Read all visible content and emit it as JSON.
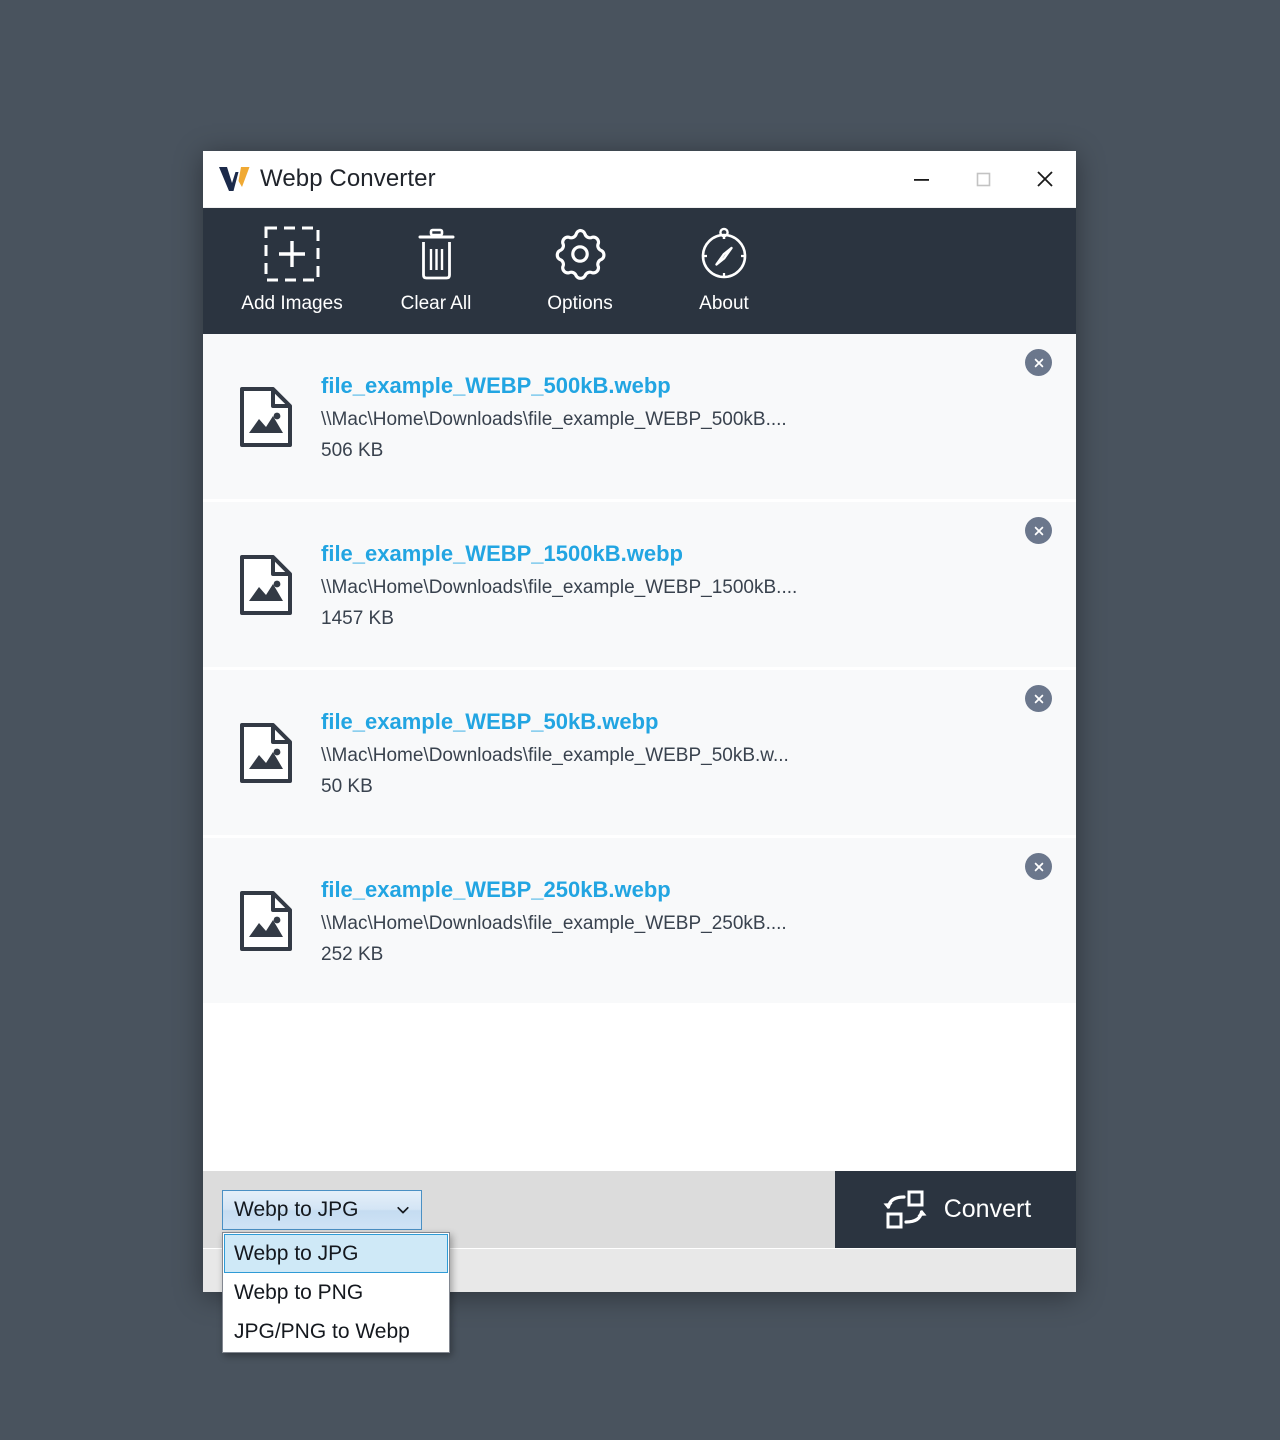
{
  "window": {
    "title": "Webp Converter",
    "logo_icon": "webp-converter-logo",
    "controls": [
      {
        "name": "minimize",
        "icon": "minimize-icon"
      },
      {
        "name": "maximize",
        "icon": "maximize-icon"
      },
      {
        "name": "close",
        "icon": "close-icon"
      }
    ]
  },
  "toolbar": {
    "items": [
      {
        "label": "Add Images",
        "icon": "add-images-icon"
      },
      {
        "label": "Clear All",
        "icon": "trash-icon"
      },
      {
        "label": "Options",
        "icon": "gear-icon"
      },
      {
        "label": "About",
        "icon": "compass-icon"
      }
    ]
  },
  "file_list": {
    "remove_icon": "close-circle-icon",
    "file_icon": "image-file-icon",
    "items": [
      {
        "name": "file_example_WEBP_500kB.webp",
        "path": "\\\\Mac\\Home\\Downloads\\file_example_WEBP_500kB....",
        "size": "506 KB"
      },
      {
        "name": "file_example_WEBP_1500kB.webp",
        "path": "\\\\Mac\\Home\\Downloads\\file_example_WEBP_1500kB....",
        "size": "1457 KB"
      },
      {
        "name": "file_example_WEBP_50kB.webp",
        "path": "\\\\Mac\\Home\\Downloads\\file_example_WEBP_50kB.w...",
        "size": "50 KB"
      },
      {
        "name": "file_example_WEBP_250kB.webp",
        "path": "\\\\Mac\\Home\\Downloads\\file_example_WEBP_250kB....",
        "size": "252 KB"
      }
    ]
  },
  "action_bar": {
    "format_select": {
      "selected": "Webp to JPG",
      "chevron_icon": "chevron-down-icon",
      "options": [
        "Webp to JPG",
        "Webp to PNG",
        "JPG/PNG to Webp"
      ],
      "open": true
    },
    "convert": {
      "label": "Convert",
      "icon": "convert-cycle-icon"
    }
  },
  "status_bar": {
    "text": ""
  },
  "colors": {
    "toolbar_bg": "#2b3440",
    "accent_link": "#22a5e2",
    "logo_gold": "#f0a933",
    "logo_navy": "#1c2a4a",
    "desktop_bg": "#49535e",
    "remove_btn": "#6b778c",
    "dropdown_highlight": "#cfe9f7"
  }
}
